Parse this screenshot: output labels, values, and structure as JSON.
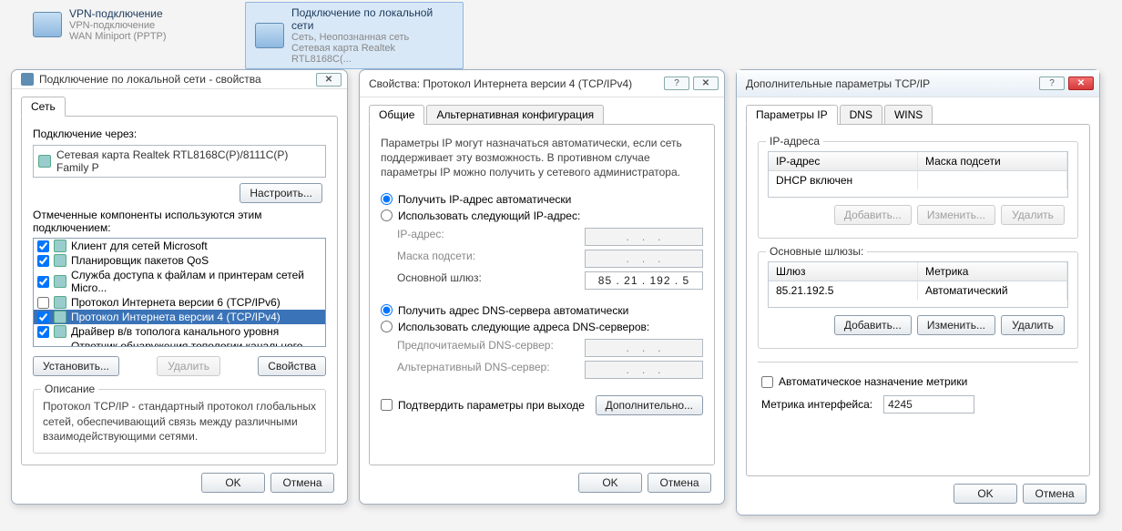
{
  "net_items": [
    {
      "title": "VPN-подключение",
      "sub1": "VPN-подключение",
      "sub2": "WAN Miniport (PPTP)"
    },
    {
      "title": "Подключение по локальной сети",
      "sub1": "Сеть, Неопознанная сеть",
      "sub2": "Сетевая карта Realtek RTL8168C(..."
    }
  ],
  "dlg1": {
    "title": "Подключение по локальной сети - свойства",
    "tab_net": "Сеть",
    "connect_via": "Подключение через:",
    "adapter": "Сетевая карта Realtek RTL8168C(P)/8111C(P) Family P",
    "configure": "Настроить...",
    "components_label": "Отмеченные компоненты используются этим подключением:",
    "components": [
      {
        "chk": true,
        "label": "Клиент для сетей Microsoft"
      },
      {
        "chk": true,
        "label": "Планировщик пакетов QoS"
      },
      {
        "chk": true,
        "label": "Служба доступа к файлам и принтерам сетей Micro..."
      },
      {
        "chk": false,
        "label": "Протокол Интернета версии 6 (TCP/IPv6)"
      },
      {
        "chk": true,
        "label": "Протокол Интернета версии 4 (TCP/IPv4)",
        "sel": true
      },
      {
        "chk": true,
        "label": "Драйвер в/в тополога канального уровня"
      },
      {
        "chk": true,
        "label": "Ответчик обнаружения топологии канального уровня"
      }
    ],
    "install": "Установить...",
    "uninstall": "Удалить",
    "properties": "Свойства",
    "desc_legend": "Описание",
    "desc_text": "Протокол TCP/IP - стандартный протокол глобальных сетей, обеспечивающий связь между различными взаимодействующими сетями.",
    "ok": "OK",
    "cancel": "Отмена"
  },
  "dlg2": {
    "title": "Свойства: Протокол Интернета версии 4 (TCP/IPv4)",
    "tab_general": "Общие",
    "tab_alt": "Альтернативная конфигурация",
    "intro": "Параметры IP могут назначаться автоматически, если сеть поддерживает эту возможность. В противном случае параметры IP можно получить у сетевого администратора.",
    "ip_auto": "Получить IP-адрес автоматически",
    "ip_manual": "Использовать следующий IP-адрес:",
    "ip_label": "IP-адрес:",
    "mask_label": "Маска подсети:",
    "gw_label": "Основной шлюз:",
    "gw_value": "85 . 21 . 192 . 5",
    "dns_auto": "Получить адрес DNS-сервера автоматически",
    "dns_manual": "Использовать следующие адреса DNS-серверов:",
    "dns1": "Предпочитаемый DNS-сервер:",
    "dns2": "Альтернативный DNS-сервер:",
    "confirm_exit": "Подтвердить параметры при выходе",
    "advanced": "Дополнительно...",
    "ok": "OK",
    "cancel": "Отмена"
  },
  "dlg3": {
    "title": "Дополнительные параметры TCP/IP",
    "tab_ip": "Параметры IP",
    "tab_dns": "DNS",
    "tab_wins": "WINS",
    "ip_legend": "IP-адреса",
    "col_ip": "IP-адрес",
    "col_mask": "Маска подсети",
    "dhcp": "DHCP включен",
    "add": "Добавить...",
    "edit": "Изменить...",
    "del": "Удалить",
    "gw_legend": "Основные шлюзы:",
    "col_gw": "Шлюз",
    "col_metric": "Метрика",
    "gw_value": "85.21.192.5",
    "gw_metric": "Автоматический",
    "auto_metric": "Автоматическое назначение метрики",
    "if_metric": "Метрика интерфейса:",
    "if_metric_val": "4245",
    "ok": "OK",
    "cancel": "Отмена"
  }
}
